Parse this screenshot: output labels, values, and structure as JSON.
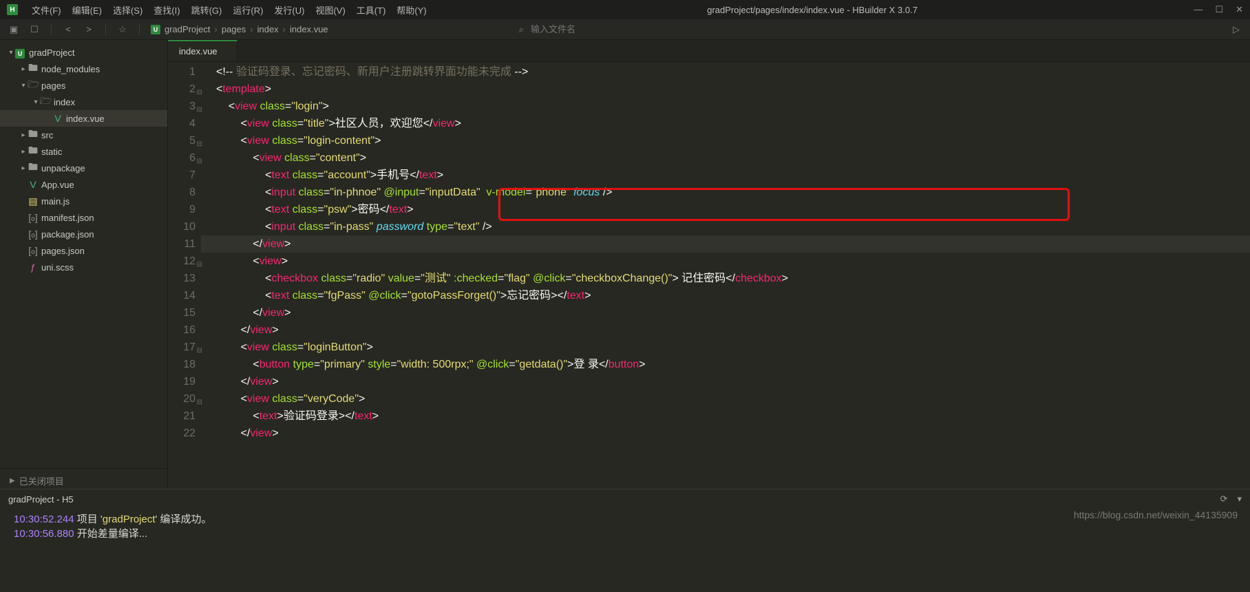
{
  "titlebar": {
    "menus": [
      "文件(F)",
      "编辑(E)",
      "选择(S)",
      "查找(I)",
      "跳转(G)",
      "运行(R)",
      "发行(U)",
      "视图(V)",
      "工具(T)",
      "帮助(Y)"
    ],
    "title": "gradProject/pages/index/index.vue - HBuilder X 3.0.7"
  },
  "toolbar": {
    "crumbs": [
      "gradProject",
      "pages",
      "index",
      "index.vue"
    ],
    "search_placeholder": "输入文件名"
  },
  "sidebar": {
    "items": [
      {
        "depth": 0,
        "arrow": "down",
        "icon": "app",
        "label": "gradProject"
      },
      {
        "depth": 1,
        "arrow": "right",
        "icon": "folder",
        "label": "node_modules"
      },
      {
        "depth": 1,
        "arrow": "down",
        "icon": "folder-open",
        "label": "pages"
      },
      {
        "depth": 2,
        "arrow": "down",
        "icon": "folder-open",
        "label": "index"
      },
      {
        "depth": 3,
        "arrow": "",
        "icon": "vue",
        "label": "index.vue",
        "selected": true
      },
      {
        "depth": 1,
        "arrow": "right",
        "icon": "folder",
        "label": "src"
      },
      {
        "depth": 1,
        "arrow": "right",
        "icon": "folder",
        "label": "static"
      },
      {
        "depth": 1,
        "arrow": "right",
        "icon": "folder",
        "label": "unpackage"
      },
      {
        "depth": 1,
        "arrow": "",
        "icon": "vue",
        "label": "App.vue"
      },
      {
        "depth": 1,
        "arrow": "",
        "icon": "js",
        "label": "main.js"
      },
      {
        "depth": 1,
        "arrow": "",
        "icon": "json",
        "label": "manifest.json"
      },
      {
        "depth": 1,
        "arrow": "",
        "icon": "json",
        "label": "package.json"
      },
      {
        "depth": 1,
        "arrow": "",
        "icon": "json",
        "label": "pages.json"
      },
      {
        "depth": 1,
        "arrow": "",
        "icon": "scss",
        "label": "uni.scss"
      }
    ],
    "closed_projects_label": "已关闭项目"
  },
  "tab": {
    "label": "index.vue"
  },
  "code": {
    "lines": [
      {
        "n": 1,
        "html": "<span class='c-pun'>&lt;!--</span><span class='c-cmt'> 验证码登录、忘记密码、新用户注册跳转界面功能未完成 </span><span class='c-pun'>--&gt;</span>"
      },
      {
        "n": 2,
        "fold": true,
        "html": "<span class='c-pun'>&lt;</span><span class='c-tag'>template</span><span class='c-pun'>&gt;</span>"
      },
      {
        "n": 3,
        "fold": true,
        "html": "    <span class='c-pun'>&lt;</span><span class='c-tag'>view</span> <span class='c-attr'>class</span><span class='c-pun'>=</span><span class='c-str'>\"login\"</span><span class='c-pun'>&gt;</span>"
      },
      {
        "n": 4,
        "html": "        <span class='c-pun'>&lt;</span><span class='c-tag'>view</span> <span class='c-attr'>class</span><span class='c-pun'>=</span><span class='c-str'>\"title\"</span><span class='c-pun'>&gt;</span><span class='c-txt'>社区人员，欢迎您</span><span class='c-pun'>&lt;/</span><span class='c-tag'>view</span><span class='c-pun'>&gt;</span>"
      },
      {
        "n": 5,
        "fold": true,
        "html": "        <span class='c-pun'>&lt;</span><span class='c-tag'>view</span> <span class='c-attr'>class</span><span class='c-pun'>=</span><span class='c-str'>\"login-content\"</span><span class='c-pun'>&gt;</span>"
      },
      {
        "n": 6,
        "fold": true,
        "html": "            <span class='c-pun'>&lt;</span><span class='c-tag'>view</span> <span class='c-attr'>class</span><span class='c-pun'>=</span><span class='c-str'>\"content\"</span><span class='c-pun'>&gt;</span>"
      },
      {
        "n": 7,
        "html": "                <span class='c-pun'>&lt;</span><span class='c-tag'>text</span> <span class='c-attr'>class</span><span class='c-pun'>=</span><span class='c-str'>\"account\"</span><span class='c-pun'>&gt;</span><span class='c-txt'>手机号</span><span class='c-pun'>&lt;/</span><span class='c-tag'>text</span><span class='c-pun'>&gt;</span>"
      },
      {
        "n": 8,
        "html": "                <span class='c-pun'>&lt;</span><span class='c-tag'>input</span> <span class='c-attr'>class</span><span class='c-pun'>=</span><span class='c-str'>\"in-phnoe\"</span> <span class='c-attr'>@input</span><span class='c-pun'>=</span><span class='c-str'>\"inputData\"</span>  <span class='c-attr'>v-model</span><span class='c-pun'>=</span><span class='c-str'>\"phone\"</span> <span class='c-kw'>focus</span> <span class='c-pun'>/&gt;</span>"
      },
      {
        "n": 9,
        "html": "                <span class='c-pun'>&lt;</span><span class='c-tag'>text</span> <span class='c-attr'>class</span><span class='c-pun'>=</span><span class='c-str'>\"psw\"</span><span class='c-pun'>&gt;</span><span class='c-txt'>密码</span><span class='c-pun'>&lt;/</span><span class='c-tag'>text</span><span class='c-pun'>&gt;</span>"
      },
      {
        "n": 10,
        "html": "                <span class='c-pun'>&lt;</span><span class='c-tag'>input</span> <span class='c-attr'>class</span><span class='c-pun'>=</span><span class='c-str'>\"in-pass\"</span> <span class='c-kw'>password</span> <span class='c-attr'>type</span><span class='c-pun'>=</span><span class='c-str'>\"text\"</span> <span class='c-pun'>/&gt;</span>"
      },
      {
        "n": 11,
        "current": true,
        "html": "            <span class='c-pun'>&lt;/</span><span class='c-tag'>view</span><span class='c-pun'>&gt;</span>"
      },
      {
        "n": 12,
        "fold": true,
        "html": "            <span class='c-pun'>&lt;</span><span class='c-tag'>view</span><span class='c-pun'>&gt;</span>"
      },
      {
        "n": 13,
        "html": "                <span class='c-pun'>&lt;</span><span class='c-tag'>checkbox</span> <span class='c-attr'>class</span><span class='c-pun'>=</span><span class='c-str'>\"radio\"</span> <span class='c-attr'>value</span><span class='c-pun'>=</span><span class='c-str'>\"测试\"</span> <span class='c-attr'>:checked</span><span class='c-pun'>=</span><span class='c-str'>\"flag\"</span> <span class='c-attr'>@click</span><span class='c-pun'>=</span><span class='c-str'>\"checkboxChange()\"</span><span class='c-pun'>&gt;</span><span class='c-txt'> 记住密码</span><span class='c-pun'>&lt;/</span><span class='c-tag'>checkbox</span><span class='c-pun'>&gt;</span>"
      },
      {
        "n": 14,
        "html": "                <span class='c-pun'>&lt;</span><span class='c-tag'>text</span> <span class='c-attr'>class</span><span class='c-pun'>=</span><span class='c-str'>\"fgPass\"</span> <span class='c-attr'>@click</span><span class='c-pun'>=</span><span class='c-str'>\"gotoPassForget()\"</span><span class='c-pun'>&gt;</span><span class='c-txt'>忘记密码&gt;</span><span class='c-pun'>&lt;/</span><span class='c-tag'>text</span><span class='c-pun'>&gt;</span>"
      },
      {
        "n": 15,
        "html": "            <span class='c-pun'>&lt;/</span><span class='c-tag'>view</span><span class='c-pun'>&gt;</span>"
      },
      {
        "n": 16,
        "html": "        <span class='c-pun'>&lt;/</span><span class='c-tag'>view</span><span class='c-pun'>&gt;</span>"
      },
      {
        "n": 17,
        "fold": true,
        "html": "        <span class='c-pun'>&lt;</span><span class='c-tag'>view</span> <span class='c-attr'>class</span><span class='c-pun'>=</span><span class='c-str'>\"loginButton\"</span><span class='c-pun'>&gt;</span>"
      },
      {
        "n": 18,
        "html": "            <span class='c-pun'>&lt;</span><span class='c-tag'>button</span> <span class='c-attr'>type</span><span class='c-pun'>=</span><span class='c-str'>\"primary\"</span> <span class='c-attr'>style</span><span class='c-pun'>=</span><span class='c-str'>\"width: 500rpx;\"</span> <span class='c-attr'>@click</span><span class='c-pun'>=</span><span class='c-str'>\"getdata()\"</span><span class='c-pun'>&gt;</span><span class='c-txt'>登 录</span><span class='c-pun'>&lt;/</span><span class='c-tag'>button</span><span class='c-pun'>&gt;</span>"
      },
      {
        "n": 19,
        "html": "        <span class='c-pun'>&lt;/</span><span class='c-tag'>view</span><span class='c-pun'>&gt;</span>"
      },
      {
        "n": 20,
        "fold": true,
        "html": "        <span class='c-pun'>&lt;</span><span class='c-tag'>view</span> <span class='c-attr'>class</span><span class='c-pun'>=</span><span class='c-str'>\"veryCode\"</span><span class='c-pun'>&gt;</span>"
      },
      {
        "n": 21,
        "html": "            <span class='c-pun'>&lt;</span><span class='c-tag'>text</span><span class='c-pun'>&gt;</span><span class='c-txt'>验证码登录&gt;</span><span class='c-pun'>&lt;/</span><span class='c-tag'>text</span><span class='c-pun'>&gt;</span>"
      },
      {
        "n": 22,
        "html": "        <span class='c-pun'>&lt;/</span><span class='c-tag'>view</span><span class='c-pun'>&gt;</span>"
      }
    ]
  },
  "console": {
    "title": "gradProject - H5",
    "lines": [
      {
        "ts": "10:30:52.244",
        "text": " 项目 '",
        "em": "gradProject",
        "text2": "' 编译成功。"
      },
      {
        "ts": "10:30:56.880",
        "text": " 开始差量编译..."
      }
    ]
  },
  "watermark": "https://blog.csdn.net/weixin_44135909"
}
